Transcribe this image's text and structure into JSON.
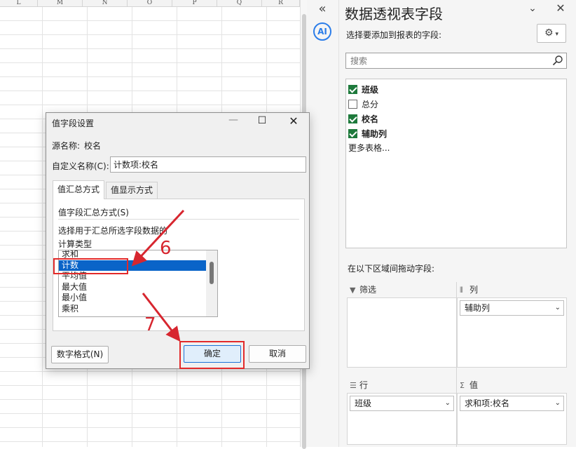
{
  "sheet": {
    "columns": [
      "L",
      "M",
      "N",
      "O",
      "P",
      "Q",
      "R"
    ]
  },
  "side_strip": {
    "collapse_icon": "double-chevron-left-icon",
    "ai_label": "AI"
  },
  "pane": {
    "title": "数据透视表字段",
    "subtitle": "选择要添加到报表的字段:",
    "search_placeholder": "搜索",
    "fields": [
      {
        "label": "班级",
        "checked": true
      },
      {
        "label": "总分",
        "checked": false
      },
      {
        "label": "校名",
        "checked": true
      },
      {
        "label": "辅助列",
        "checked": true
      }
    ],
    "more_tables": "更多表格...",
    "drag_hint": "在以下区域间拖动字段:",
    "areas": {
      "filter": {
        "title": "筛选",
        "icon": "filter-icon"
      },
      "columns": {
        "title": "列",
        "icon": "columns-icon",
        "field": "辅助列"
      },
      "rows": {
        "title": "行",
        "icon": "rows-icon",
        "field": "班级"
      },
      "values": {
        "title": "值",
        "icon": "sigma-icon",
        "field": "求和项:校名"
      }
    },
    "accent_color": "#1e7a3c"
  },
  "dialog": {
    "title": "值字段设置",
    "source_label": "源名称:",
    "source_value": "校名",
    "custom_name_label": "自定义名称(C):",
    "custom_name_value": "计数项:校名",
    "tabs": [
      "值汇总方式",
      "值显示方式"
    ],
    "summarize_heading": "值字段汇总方式(S)",
    "summarize_desc_line1": "选择用于汇总所选字段数据的",
    "summarize_desc_line2": "计算类型",
    "calc_types": [
      "求和",
      "计数",
      "平均值",
      "最大值",
      "最小值",
      "乘积"
    ],
    "selected_calc": "计数",
    "number_format_button": "数字格式(N)",
    "ok_button": "确定",
    "cancel_button": "取消"
  },
  "annotations": {
    "step_a": "6",
    "step_b": "7",
    "color": "#d7262f"
  }
}
